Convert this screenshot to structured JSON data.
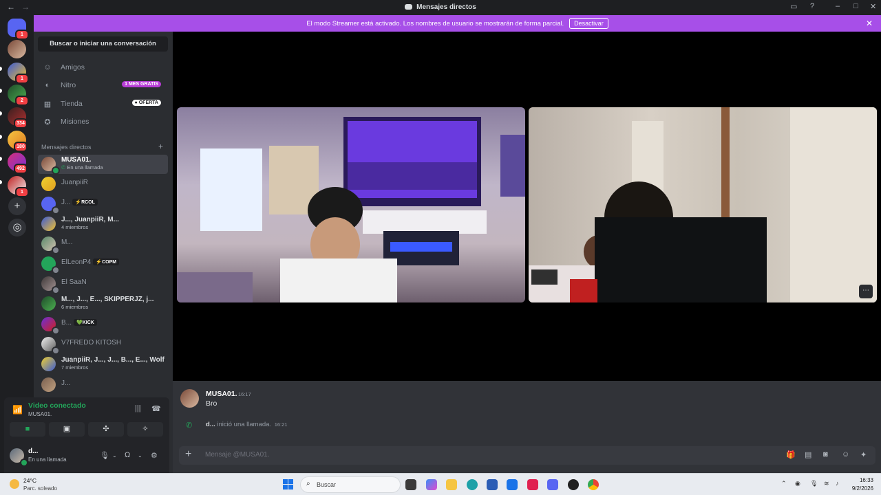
{
  "window": {
    "title": "Mensajes directos"
  },
  "banner": {
    "text": "El modo Streamer está activado. Los nombres de usuario se mostrarán de forma parcial.",
    "button": "Desactivar"
  },
  "rail": {
    "badges": [
      "1",
      "1",
      "2",
      "334",
      "180",
      "492",
      "1"
    ]
  },
  "sidebar": {
    "search_placeholder": "Buscar o iniciar una conversación",
    "nav": [
      {
        "label": "Amigos",
        "icon": "friends-icon"
      },
      {
        "label": "Nitro",
        "icon": "nitro-icon",
        "tag": "1 MES GRATIS"
      },
      {
        "label": "Tienda",
        "icon": "shop-icon",
        "tag": "OFERTA"
      },
      {
        "label": "Misiones",
        "icon": "quests-icon"
      }
    ],
    "dm_header": "Mensajes directos",
    "dms": [
      {
        "name": "MUSA01.",
        "sub": "En una llamada"
      },
      {
        "name": "JuanpiiR"
      },
      {
        "name": "J...",
        "chip": "RCOL"
      },
      {
        "name": "J..., JuanpiiR, M...",
        "sub": "4 miembros"
      },
      {
        "name": "M..."
      },
      {
        "name": "ElLeonP4",
        "chip": "COPM"
      },
      {
        "name": "El SaaN"
      },
      {
        "name": "M..., J..., E..., SKIPPERJZ, j...",
        "sub": "6 miembros"
      },
      {
        "name": "B...",
        "chip": "KICK"
      },
      {
        "name": "V7FREDO KITOSH"
      },
      {
        "name": "JuanpiiR, J..., J..., B..., E..., Wolf...",
        "sub": "7 miembros"
      },
      {
        "name": "J..."
      }
    ]
  },
  "voice": {
    "status": "Video conectado",
    "channel": "MUSA01."
  },
  "user": {
    "name": "d...",
    "status": "En una llamada"
  },
  "chat": {
    "message": {
      "author": "MUSA01.",
      "time": "16:17",
      "text": "Bro"
    },
    "call": {
      "who": "d...",
      "text": "inició una llamada.",
      "time": "16:21"
    },
    "placeholder": "Mensaje @MUSA01."
  },
  "taskbar": {
    "weather_temp": "24°C",
    "weather_desc": "Parc. soleado",
    "search": "Buscar",
    "time": "16:33",
    "date": "9/2/2026"
  }
}
